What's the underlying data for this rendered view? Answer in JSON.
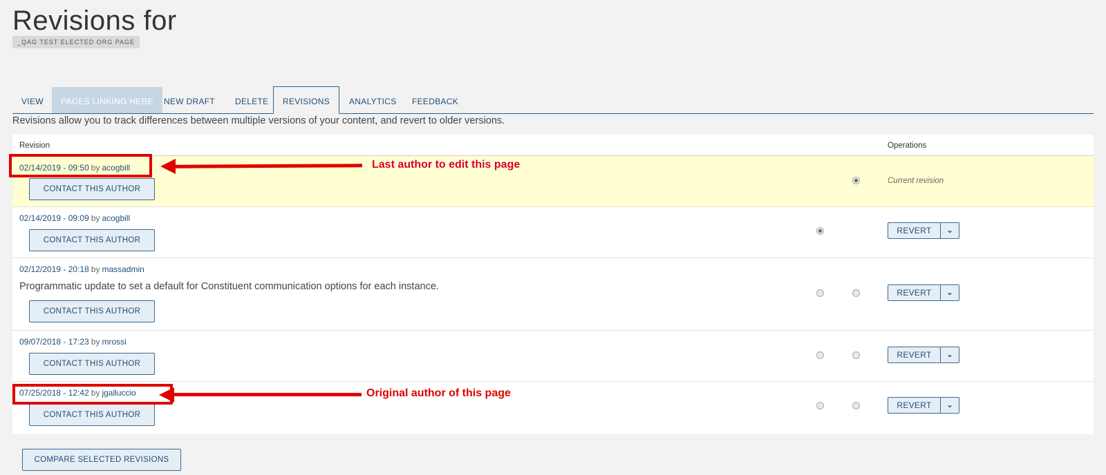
{
  "page": {
    "title": "Revisions for",
    "subtitle_tag": "_QAG TEST ELECTED ORG PAGE",
    "intro": "Revisions allow you to track differences between multiple versions of your content, and revert to older versions."
  },
  "tabs": [
    {
      "label": "VIEW"
    },
    {
      "label": "PAGES LINKING HERE"
    },
    {
      "label": "NEW DRAFT"
    },
    {
      "label": "DELETE"
    },
    {
      "label": "REVISIONS"
    },
    {
      "label": "ANALYTICS"
    },
    {
      "label": "FEEDBACK"
    }
  ],
  "table": {
    "col_revision": "Revision",
    "col_operations": "Operations",
    "current_label": "Current revision",
    "contact_label": "CONTACT THIS AUTHOR",
    "revert_label": "REVERT",
    "by": "by",
    "rows": [
      {
        "date": "02/14/2019 - 09:50",
        "author": "acogbill",
        "message": "",
        "current": true
      },
      {
        "date": "02/14/2019 - 09:09",
        "author": "acogbill",
        "message": "",
        "current": false
      },
      {
        "date": "02/12/2019 - 20:18",
        "author": "massadmin",
        "message": "Programmatic update to set a default for Constituent communication options for each instance.",
        "current": false
      },
      {
        "date": "09/07/2018 - 17:23",
        "author": "mrossi",
        "message": "",
        "current": false
      },
      {
        "date": "07/25/2018 - 12:42",
        "author": "jgalluccio",
        "message": "",
        "current": false
      }
    ]
  },
  "compare_button": "COMPARE SELECTED REVISIONS",
  "annotations": {
    "last_author": "Last author to edit this page",
    "original_author": "Original author of this page"
  },
  "colors": {
    "accent": "#1f4e79",
    "highlight": "#ffffd1",
    "annotation": "#e00000"
  }
}
